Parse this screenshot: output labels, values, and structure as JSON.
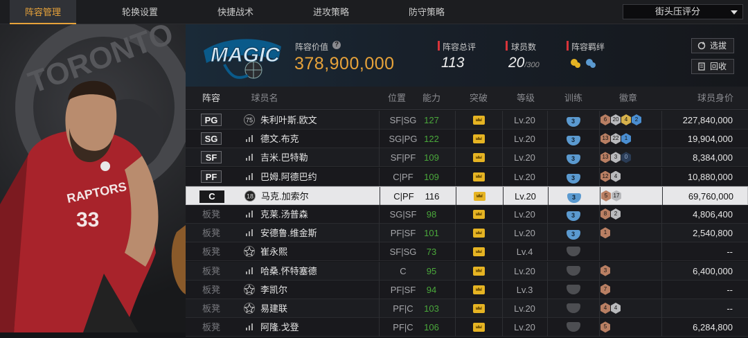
{
  "nav": {
    "tabs": [
      "阵容管理",
      "轮换设置",
      "快捷战术",
      "进攻策略",
      "防守策略"
    ],
    "active_index": 0,
    "rating_select": "街头压评分"
  },
  "team": {
    "logo_text": "MAGIC",
    "value_label": "阵容价值",
    "value": "378,900,000",
    "total_label": "阵容总评",
    "total": "113",
    "count_label": "球员数",
    "count": "20",
    "count_max": "/300",
    "bond_label": "阵容羁绊",
    "buttons": {
      "select": "选拔",
      "recycle": "回收"
    }
  },
  "table": {
    "headers": [
      "阵容",
      "球员名",
      "位置",
      "能力",
      "突破",
      "等级",
      "训练",
      "徽章",
      "球员身价"
    ],
    "rows": [
      {
        "slot": "PG",
        "name": "朱利叶斯.欧文",
        "pos": "SF|SG",
        "ability": "127",
        "level": "Lv.20",
        "train": "3",
        "badges": [
          [
            "b-bronze",
            "6"
          ],
          [
            "b-silver",
            "20"
          ],
          [
            "b-gold",
            "4"
          ],
          [
            "b-blue",
            "2"
          ]
        ],
        "value": "227,840,000",
        "icon": "75"
      },
      {
        "slot": "SG",
        "name": "德文.布克",
        "pos": "SG|PG",
        "ability": "122",
        "level": "Lv.20",
        "train": "3",
        "badges": [
          [
            "b-bronze",
            "13"
          ],
          [
            "b-silver",
            "22"
          ],
          [
            "b-blue",
            "1"
          ]
        ],
        "value": "19,904,000",
        "icon": ""
      },
      {
        "slot": "SF",
        "name": "吉米.巴特勒",
        "pos": "SF|PF",
        "ability": "109",
        "level": "Lv.20",
        "train": "3",
        "badges": [
          [
            "b-bronze",
            "13"
          ],
          [
            "b-silver",
            "3"
          ],
          [
            "b-dark",
            "0"
          ]
        ],
        "value": "8,384,000",
        "icon": ""
      },
      {
        "slot": "PF",
        "name": "巴姆.阿德巴约",
        "pos": "C|PF",
        "ability": "109",
        "level": "Lv.20",
        "train": "3",
        "badges": [
          [
            "b-bronze",
            "12"
          ],
          [
            "b-silver",
            "4"
          ]
        ],
        "value": "10,880,000",
        "icon": ""
      },
      {
        "slot": "C",
        "name": "马克.加索尔",
        "pos": "C|PF",
        "ability": "116",
        "level": "Lv.20",
        "train": "3",
        "badges": [
          [
            "b-bronze",
            "5"
          ],
          [
            "b-silver",
            "17"
          ]
        ],
        "value": "69,760,000",
        "icon": "18",
        "selected": true
      },
      {
        "slot": "板凳",
        "name": "克莱.汤普森",
        "pos": "SG|SF",
        "ability": "98",
        "level": "Lv.20",
        "train": "3",
        "badges": [
          [
            "b-bronze",
            "8"
          ],
          [
            "b-silver",
            "2"
          ]
        ],
        "value": "4,806,400",
        "icon": ""
      },
      {
        "slot": "板凳",
        "name": "安德鲁.维金斯",
        "pos": "PF|SF",
        "ability": "101",
        "level": "Lv.20",
        "train": "3",
        "badges": [
          [
            "b-bronze",
            "1"
          ]
        ],
        "value": "2,540,800",
        "icon": ""
      },
      {
        "slot": "板凳",
        "name": "崔永熙",
        "pos": "SF|SG",
        "ability": "73",
        "level": "Lv.4",
        "train": "",
        "badges": [],
        "value": "--",
        "icon": "star"
      },
      {
        "slot": "板凳",
        "name": "哈桑.怀特塞德",
        "pos": "C",
        "ability": "95",
        "level": "Lv.20",
        "train": "",
        "badges": [
          [
            "b-bronze",
            "3"
          ]
        ],
        "value": "6,400,000",
        "icon": ""
      },
      {
        "slot": "板凳",
        "name": "李凯尔",
        "pos": "PF|SF",
        "ability": "94",
        "level": "Lv.3",
        "train": "",
        "badges": [
          [
            "b-bronze",
            "7"
          ]
        ],
        "value": "--",
        "icon": "star"
      },
      {
        "slot": "板凳",
        "name": "易建联",
        "pos": "PF|C",
        "ability": "103",
        "level": "Lv.20",
        "train": "",
        "badges": [
          [
            "b-bronze",
            "4"
          ],
          [
            "b-silver",
            "4"
          ]
        ],
        "value": "--",
        "icon": "star"
      },
      {
        "slot": "板凳",
        "name": "阿隆.戈登",
        "pos": "PF|C",
        "ability": "106",
        "level": "Lv.20",
        "train": "",
        "badges": [
          [
            "b-bronze",
            "5"
          ]
        ],
        "value": "6,284,800",
        "icon": ""
      }
    ]
  },
  "art": {
    "team_text": "TORONTO",
    "jersey_text": "RAPTORS",
    "jersey_number": "33"
  },
  "colors": {
    "accent": "#e8a33a",
    "ability_green": "#4aa83b",
    "red_marker": "#d8343a"
  }
}
